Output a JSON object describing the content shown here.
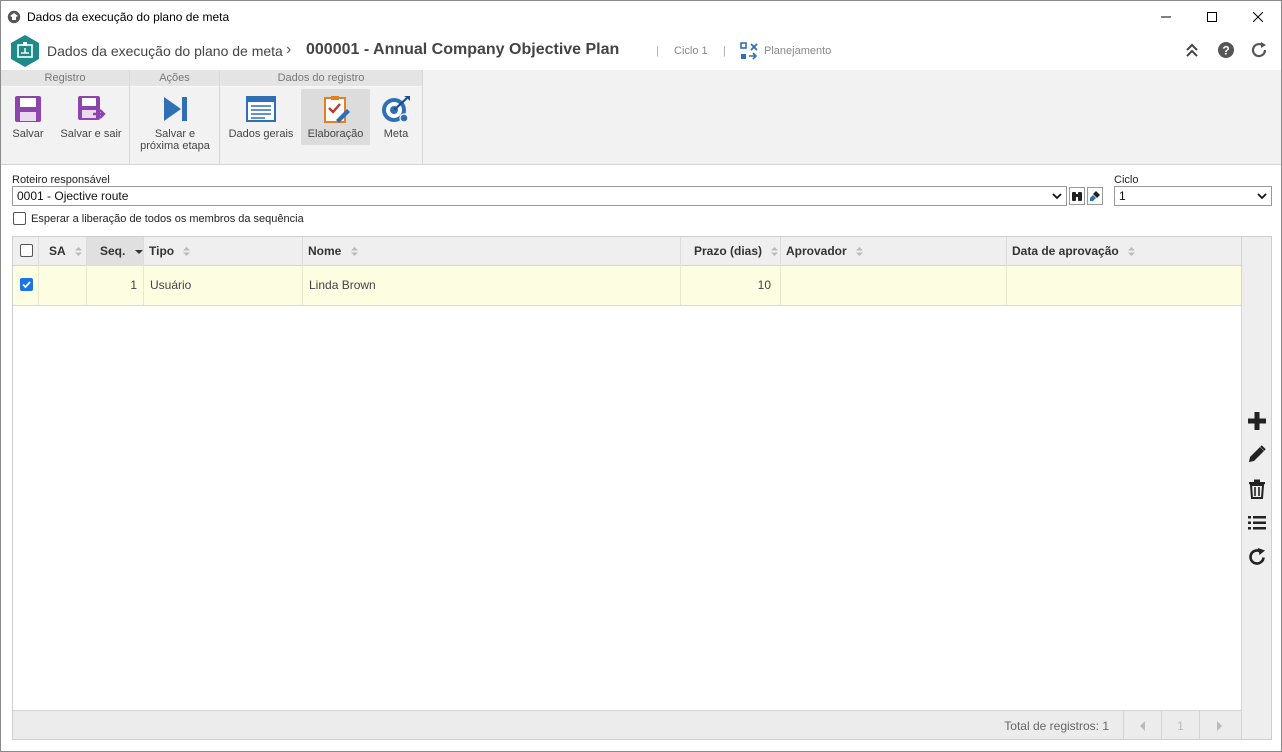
{
  "window": {
    "title": "Dados da execução do plano de meta"
  },
  "header": {
    "breadcrumb_main": "Dados da execução do plano de meta",
    "breadcrumb_sep": "›",
    "record_title": "000001 - Annual Company Objective Plan",
    "divider": "|",
    "cycle": "Ciclo 1",
    "stage": "Planejamento"
  },
  "ribbon": {
    "groups": [
      {
        "title": "Registro"
      },
      {
        "title": "Ações"
      },
      {
        "title": "Dados do registro"
      }
    ],
    "buttons": {
      "save": "Salvar",
      "save_exit": "Salvar e sair",
      "save_next_1": "Salvar e",
      "save_next_2": "próxima etapa",
      "general": "Dados gerais",
      "elaboration": "Elaboração",
      "goal": "Meta"
    }
  },
  "form": {
    "route_label": "Roteiro responsável",
    "route_value": "0001 - Ojective route",
    "cycle_label": "Ciclo",
    "cycle_value": "1",
    "wait_label": "Esperar a liberação de todos os membros da sequência",
    "wait_checked": false
  },
  "grid": {
    "columns": [
      "SA",
      "Seq.",
      "Tipo",
      "Nome",
      "Prazo (dias)",
      "Aprovador",
      "Data de aprovação"
    ],
    "sorted_column": "Seq.",
    "rows": [
      {
        "selected": true,
        "sa": "",
        "seq": "1",
        "tipo": "Usuário",
        "nome": "Linda Brown",
        "prazo": "10",
        "aprovador": "",
        "data": ""
      }
    ],
    "total_label": "Total de registros: 1",
    "page": "1",
    "side_tools": [
      "add-icon",
      "edit-icon",
      "delete-icon",
      "list-icon",
      "refresh-icon"
    ]
  },
  "colors": {
    "accent": "#1a73e8",
    "logo": "#1e8a8a",
    "row_highlight": "#fdfde2",
    "purple": "#8e44ad",
    "blue": "#2f6fb5"
  }
}
